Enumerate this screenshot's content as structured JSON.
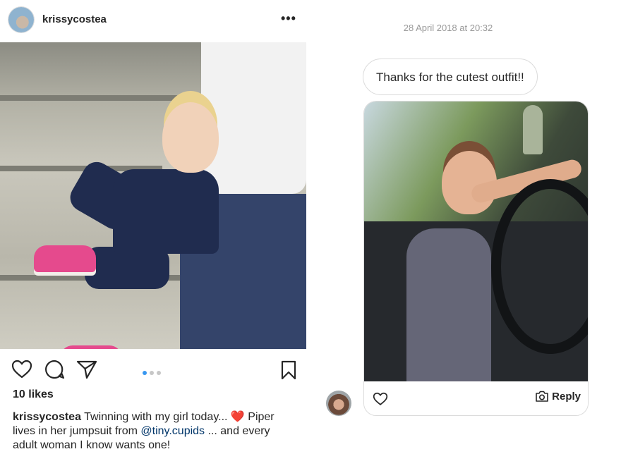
{
  "post": {
    "username": "krissycostea",
    "more_icon": "more-horizontal-icon",
    "likes": "10 likes",
    "caption": {
      "user": "krissycostea",
      "text_before": " Twinning with my girl today... ",
      "heart": "❤️",
      "text_middle": " Piper lives in her jumpsuit from ",
      "mention": "@tiny.cupids",
      "text_after": " ... and every adult woman I know wants one!"
    },
    "carousel": {
      "total": 3,
      "active": 1
    }
  },
  "dm": {
    "timestamp": "28 April 2018 at 20:32",
    "message": "Thanks for the cutest outfit!!",
    "reply_label": "Reply"
  },
  "icons": [
    "heart-icon",
    "comment-icon",
    "share-icon",
    "bookmark-icon",
    "camera-icon"
  ],
  "colors": {
    "text": "#262626",
    "muted": "#999999",
    "accent": "#3897f0",
    "border": "#dbdbdb"
  }
}
